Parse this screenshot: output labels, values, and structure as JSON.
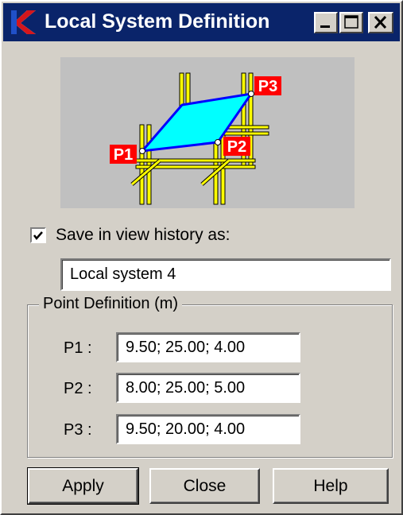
{
  "window": {
    "title": "Local System Definition",
    "controls": [
      "minimize",
      "maximize",
      "close"
    ]
  },
  "preview": {
    "point_labels": [
      "P1",
      "P2",
      "P3"
    ],
    "colors": {
      "plane_fill": "#00ffff",
      "plane_edge": "#0000ff",
      "grid": "#ffff00",
      "label_bg": "#ff0000",
      "label_text": "#ffffff"
    }
  },
  "save_history": {
    "checked": true,
    "label": "Save in view history as:",
    "name_value": "Local system 4"
  },
  "point_definition": {
    "group_label": "Point Definition (m)",
    "points": [
      {
        "label": "P1 :",
        "value": "9.50; 25.00; 4.00"
      },
      {
        "label": "P2 :",
        "value": "8.00; 25.00; 5.00"
      },
      {
        "label": "P3 :",
        "value": "9.50; 20.00; 4.00"
      }
    ]
  },
  "buttons": {
    "apply": "Apply",
    "close": "Close",
    "help": "Help"
  },
  "icons": {
    "app": "app-logo-icon",
    "minimize": "minimize-icon",
    "maximize": "maximize-icon",
    "close": "close-icon",
    "check": "check-icon"
  }
}
